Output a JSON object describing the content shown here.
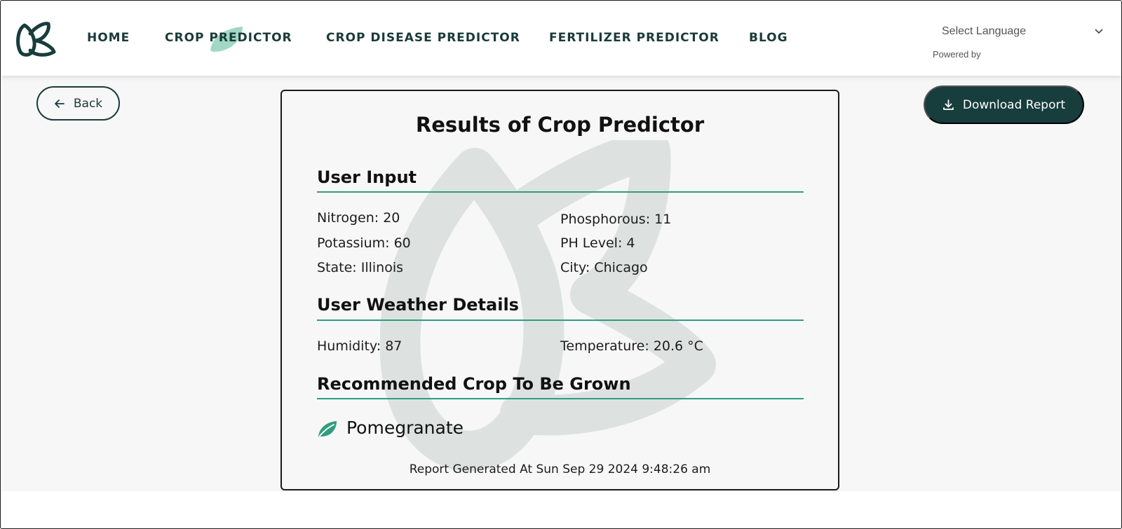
{
  "nav": {
    "links": [
      "HOME",
      "CROP PREDICTOR",
      "CROP DISEASE PREDICTOR",
      "FERTILIZER PREDICTOR",
      "BLOG"
    ],
    "active_link": "CROP PREDICTOR"
  },
  "language": {
    "selected": "Select Language",
    "powered_by": "Powered by"
  },
  "actions": {
    "back_label": "Back",
    "download_label": "Download Report"
  },
  "report": {
    "title": "Results of Crop Predictor",
    "user_input": {
      "heading": "User Input",
      "nitrogen": "Nitrogen: 20",
      "phosphorous": "Phosphorous: 11",
      "potassium": "Potassium: 60",
      "ph_level": "PH Level: 4",
      "state": "State: Illinois",
      "city": "City: Chicago"
    },
    "weather": {
      "heading": "User Weather Details",
      "humidity": "Humidity: 87",
      "temperature": "Temperature: 20.6 °C"
    },
    "recommendation": {
      "heading": "Recommended Crop To Be Grown",
      "crop": "Pomegranate"
    },
    "generated_at": "Report Generated At Sun Sep 29 2024 9:48:26 am"
  },
  "colors": {
    "brand_dark": "#173d3d",
    "accent_green": "#2e9e7e",
    "highlight_leaf": "#8fd1b8",
    "watermark": "#dde2e1"
  },
  "icons": {
    "logo": "leaf-logo-icon",
    "back": "arrow-left-icon",
    "download": "download-icon",
    "language_dropdown": "chevron-down-icon",
    "crop": "leaf-icon"
  }
}
